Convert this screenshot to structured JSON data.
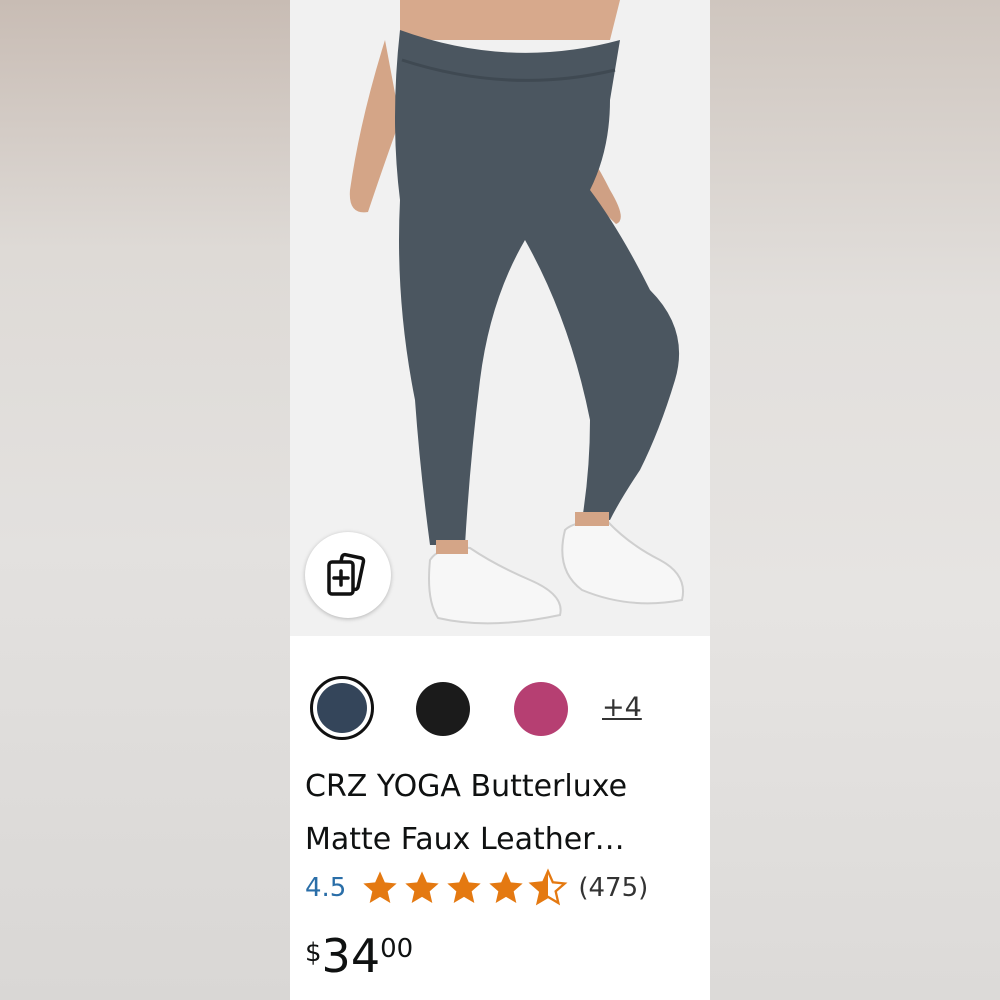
{
  "product": {
    "title_line1": "CRZ YOGA Butterluxe",
    "title_line2": "Matte Faux Leather…",
    "rating": "4.5",
    "stars_filled": 4.5,
    "review_count": "(475)",
    "price_symbol": "$",
    "price_whole": "34",
    "price_fraction": "00",
    "more_colors": "+4"
  },
  "swatches": [
    {
      "color": "#34455a",
      "selected": true
    },
    {
      "color": "#1b1b1b",
      "selected": false
    },
    {
      "color": "#b63f72",
      "selected": false
    }
  ],
  "icons": {
    "compare": "add-to-compare-icon",
    "star": "star-icon"
  },
  "colors": {
    "star": "#e47911",
    "rating_link": "#2a6ea8"
  }
}
